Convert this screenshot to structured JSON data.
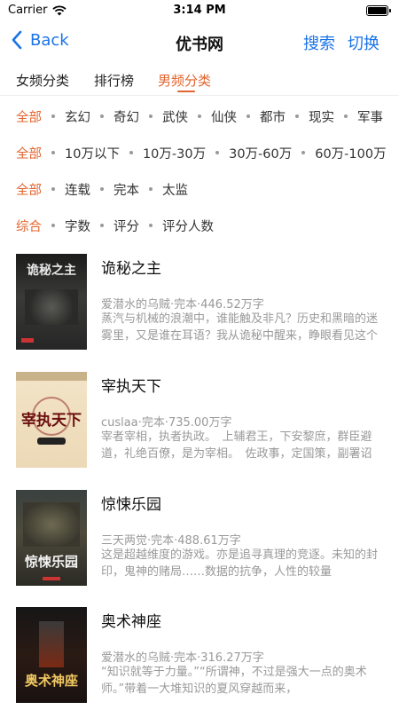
{
  "status": {
    "carrier": "Carrier",
    "time": "3:14 PM",
    "battery_level": 1.0
  },
  "nav": {
    "back_label": "Back",
    "title": "优书网",
    "search_label": "搜索",
    "switch_label": "切换"
  },
  "tabs": [
    {
      "label": "女频分类",
      "active": false
    },
    {
      "label": "排行榜",
      "active": false
    },
    {
      "label": "男频分类",
      "active": true
    }
  ],
  "filters": {
    "genre": [
      "全部",
      "玄幻",
      "奇幻",
      "武侠",
      "仙侠",
      "都市",
      "现实",
      "军事"
    ],
    "words": [
      "全部",
      "10万以下",
      "10万-30万",
      "30万-60万",
      "60万-100万"
    ],
    "status": [
      "全部",
      "连载",
      "完本",
      "太监"
    ],
    "sort": [
      "综合",
      "字数",
      "评分",
      "评分人数"
    ]
  },
  "books": [
    {
      "title": "诡秘之主",
      "meta": "爱潜水的乌贼·完本·446.52万字",
      "desc": "蒸汽与机械的浪潮中，谁能触及非凡？历史和黑暗的迷雾里，又是谁在耳语？我从诡秘中醒来，睁眼看见这个世界：",
      "cover_text": "诡秘之主"
    },
    {
      "title": "宰执天下",
      "meta": "cuslaa·完本·735.00万字",
      "desc": "宰者宰相，执者执政。　上辅君王，下安黎庶，群臣避道，礼绝百僚，是为宰相。　佐政事，定国策，副署诏令",
      "cover_text": "宰执天下"
    },
    {
      "title": "惊悚乐园",
      "meta": "三天两觉·完本·488.61万字",
      "desc": "这是超越维度的游戏。亦是追寻真理的竞逐。未知的封印，鬼神的赌局……数据的抗争，人性的较量",
      "cover_text": "惊悚乐园"
    },
    {
      "title": "奥术神座",
      "meta": "爱潜水的乌贼·完本·316.27万字",
      "desc": "“知识就等于力量。”“所谓神，不过是强大一点的奥术师。”带着一大堆知识的夏风穿越而来，",
      "cover_text": "奥术神座"
    }
  ]
}
